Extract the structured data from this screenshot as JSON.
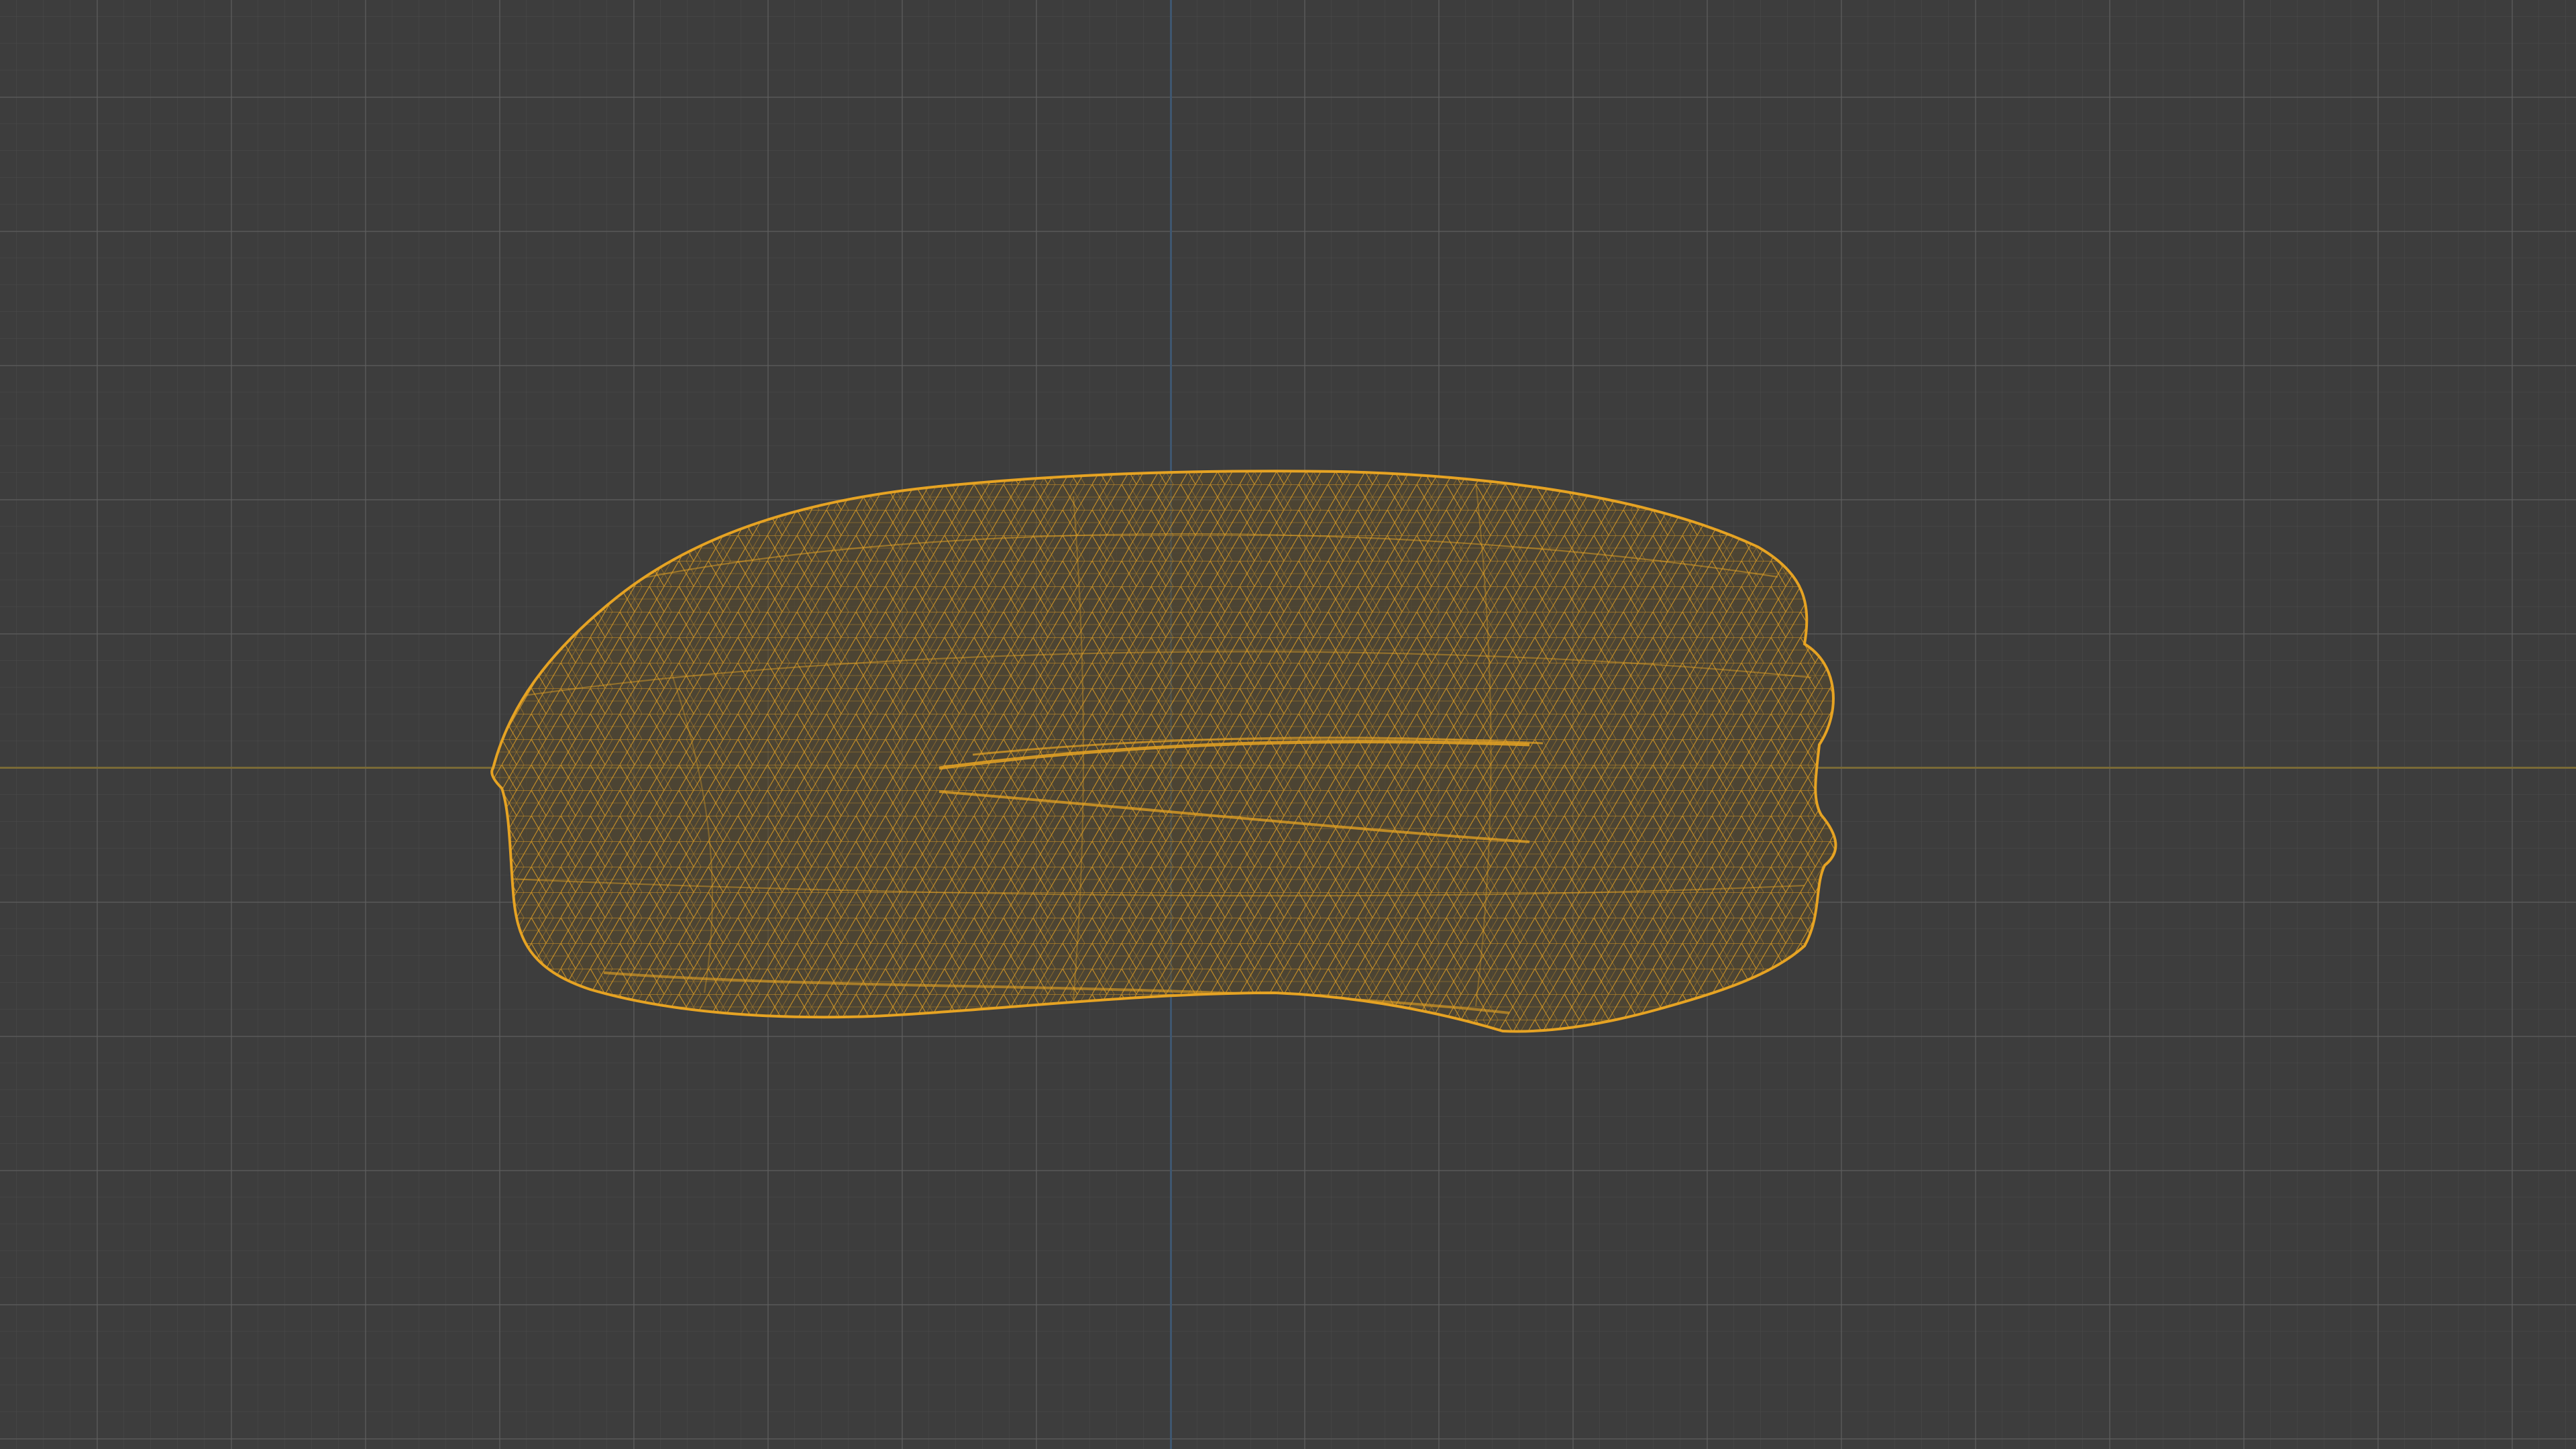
{
  "viewport": {
    "background_color": "#3d3d3d",
    "grid_major_color": "#5f5f5f",
    "grid_minor_color": "#4e4e4e",
    "x_axis_color": "#7a6a36",
    "y_axis_color": "#3f5770"
  },
  "object": {
    "display_mode": "wireframe",
    "wire_color": "#e6a323",
    "fill_color": "#5a4a2c"
  }
}
